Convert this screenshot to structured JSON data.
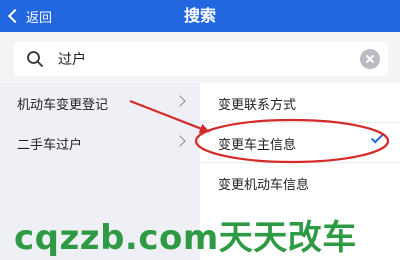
{
  "header": {
    "back_label": "返回",
    "title": "搜索",
    "color": "#2266e0"
  },
  "search": {
    "value": "过户",
    "placeholder": ""
  },
  "categories": [
    {
      "label": "机动车变更登记"
    },
    {
      "label": "二手车过户"
    }
  ],
  "results": [
    {
      "label": "变更联系方式",
      "checked": false
    },
    {
      "label": "变更车主信息",
      "checked": true
    },
    {
      "label": "变更机动车信息",
      "checked": false
    }
  ],
  "annotation": {
    "color": "#d42a2a"
  },
  "watermark": {
    "text": "cqzzb.com天天改车",
    "color": "#2f9a44"
  }
}
